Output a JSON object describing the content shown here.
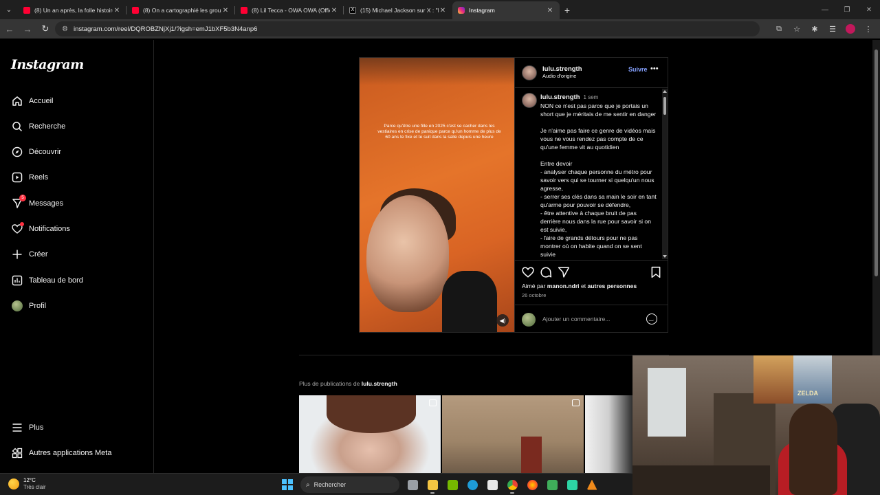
{
  "browser": {
    "tabs": [
      {
        "title": "(8) Un an après, la folle histoire",
        "kind": "yt"
      },
      {
        "title": "(8) On a cartographié les group",
        "kind": "yt"
      },
      {
        "title": "(8) Lil Tecca - OWA OWA (Offic",
        "kind": "yt"
      },
      {
        "title": "(15) Michael Jackson sur X : \"Mi",
        "kind": "x"
      },
      {
        "title": "Instagram",
        "kind": "ig"
      }
    ],
    "new_tab": "+",
    "url": "instagram.com/reel/DQROBZNjXj1/?igsh=emJ1bXF5b3N4anp6"
  },
  "sidebar": {
    "logo": "Instagram",
    "items": [
      {
        "label": "Accueil",
        "icon": "home-icon"
      },
      {
        "label": "Recherche",
        "icon": "search-icon"
      },
      {
        "label": "Découvrir",
        "icon": "compass-icon"
      },
      {
        "label": "Reels",
        "icon": "reels-icon"
      },
      {
        "label": "Messages",
        "icon": "messenger-icon",
        "badge": "5"
      },
      {
        "label": "Notifications",
        "icon": "heart-icon"
      },
      {
        "label": "Créer",
        "icon": "plus-icon"
      },
      {
        "label": "Tableau de bord",
        "icon": "dashboard-icon"
      },
      {
        "label": "Profil",
        "icon": "avatar-icon"
      }
    ],
    "bottom": [
      {
        "label": "Plus",
        "icon": "menu-icon"
      },
      {
        "label": "Autres applications Meta",
        "icon": "meta-apps-icon"
      }
    ]
  },
  "post": {
    "username": "lulu.strength",
    "audio": "Audio d'origine",
    "follow": "Suivre",
    "more": "•••",
    "video_caption": "Parce qu'être une fille en 2025 c'est se cacher dans les vestiaires en crise de panique parce qu'un homme de plus de 60 ans te fixe et te suit dans la salle depuis une heure",
    "comment_user": "lulu.strength",
    "comment_time": "1 sem",
    "comment_text": "NON ce n'est pas parce que je portais un short que je méritais de me sentir en danger\n\nJe n'aime pas faire ce genre de vidéos mais vous ne vous rendez pas compte de ce qu'une femme vit au quotidien\n\nEntre devoir\n- analyser chaque personne du métro pour savoir vers qui se tourner si quelqu'un nous agresse,\n- serrer ses clés dans sa main le soir en tant qu'arme pour pouvoir se défendre,\n- être attentive à chaque bruit de pas derrière nous dans la rue pour savoir si on est suivie,\n- faire de grands détours pour ne pas montrer où on habite quand on se sent suivie",
    "liked_prefix": "Aimé par",
    "liked_user": "manon.ndri",
    "liked_and": "et",
    "liked_others": "autres personnes",
    "date": "26 octobre",
    "add_comment": "Ajouter un commentaire..."
  },
  "more_posts": {
    "prefix": "Plus de publications de",
    "user": "lulu.strength"
  },
  "taskbar": {
    "temp": "12°C",
    "condition": "Très clair",
    "search": "Rechercher"
  },
  "webcam": {
    "poster_text": "ZELDA"
  },
  "colors": {
    "accent": "#85a1ff",
    "badge": "#ff3040",
    "background": "#000000"
  }
}
